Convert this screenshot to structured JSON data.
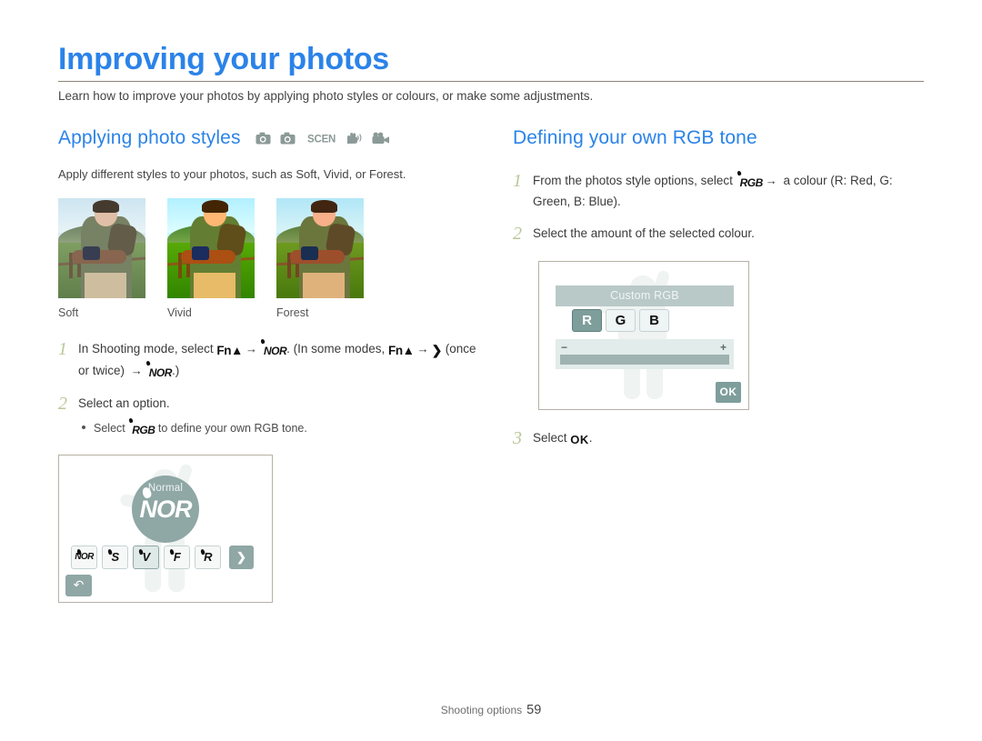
{
  "header": {
    "title": "Improving your photos",
    "intro": "Learn how to improve your photos by applying photo styles or colours, or make some adjustments."
  },
  "left_column": {
    "section_title": "Applying photo styles",
    "mode_icons": [
      "camera-icon",
      "camera-program-icon",
      "scene-icon",
      "dual-is-icon",
      "movie-icon"
    ],
    "description": "Apply different styles to your photos, such as Soft, Vivid, or Forest.",
    "samples": [
      {
        "label": "Soft"
      },
      {
        "label": "Vivid"
      },
      {
        "label": "Forest"
      }
    ],
    "steps": [
      {
        "num": "1",
        "parts": [
          {
            "t": "text",
            "v": "In Shooting mode, select "
          },
          {
            "t": "glyph",
            "v": "Fn▲",
            "k": "fn"
          },
          {
            "t": "arrow",
            "v": "→"
          },
          {
            "t": "glyph",
            "v": "NOR",
            "k": "nor"
          },
          {
            "t": "text",
            "v": ". (In some modes, "
          },
          {
            "t": "glyph",
            "v": "Fn▲",
            "k": "fn"
          },
          {
            "t": "arrow",
            "v": "→"
          },
          {
            "t": "glyph",
            "v": "❯",
            "k": "caret"
          },
          {
            "t": "text",
            "v": " (once or twice) "
          },
          {
            "t": "arrow",
            "v": "→"
          },
          {
            "t": "glyph",
            "v": "NOR",
            "k": "nor"
          },
          {
            "t": "text",
            "v": ".)"
          }
        ]
      },
      {
        "num": "2",
        "parts": [
          {
            "t": "text",
            "v": "Select an option."
          }
        ],
        "bullet": [
          {
            "t": "text",
            "v": "Select "
          },
          {
            "t": "glyph",
            "v": "RGB",
            "k": "rgb"
          },
          {
            "t": "text",
            "v": " to define your own RGB tone."
          }
        ]
      }
    ],
    "screen": {
      "mode_label": "Normal",
      "mode_glyph": "NOR",
      "style_buttons": [
        {
          "label": "NOR",
          "selected": false
        },
        {
          "label": "S",
          "selected": false
        },
        {
          "label": "V",
          "selected": true
        },
        {
          "label": "F",
          "selected": false
        },
        {
          "label": "R",
          "selected": false
        }
      ],
      "next_button": "❯",
      "back_button": "↶"
    }
  },
  "right_column": {
    "section_title": "Defining your own RGB tone",
    "steps": [
      {
        "num": "1",
        "parts": [
          {
            "t": "text",
            "v": "From the photos style options, select "
          },
          {
            "t": "glyph",
            "v": "RGB",
            "k": "rgb"
          },
          {
            "t": "arrow",
            "v": "→"
          },
          {
            "t": "text",
            "v": " a colour (R: Red, G: Green, B: Blue)."
          }
        ]
      },
      {
        "num": "2",
        "parts": [
          {
            "t": "text",
            "v": "Select the amount of the selected colour."
          }
        ]
      },
      {
        "num": "3",
        "parts": [
          {
            "t": "text",
            "v": "Select "
          },
          {
            "t": "glyph",
            "v": "OK",
            "k": "ok"
          },
          {
            "t": "text",
            "v": "."
          }
        ]
      }
    ],
    "screen": {
      "title": "Custom RGB",
      "channels": [
        {
          "label": "R",
          "selected": true
        },
        {
          "label": "G",
          "selected": false
        },
        {
          "label": "B",
          "selected": false
        }
      ],
      "minus": "−",
      "plus": "+",
      "ok_button": "OK"
    }
  },
  "footer": {
    "label": "Shooting options",
    "page": "59"
  },
  "colors": {
    "title_blue": "#2b83e8",
    "rule_gray": "#8a8579",
    "step_number": "#b9c79a",
    "ui_teal": "#8fa7a5",
    "body_text": "#3a3a3a"
  }
}
